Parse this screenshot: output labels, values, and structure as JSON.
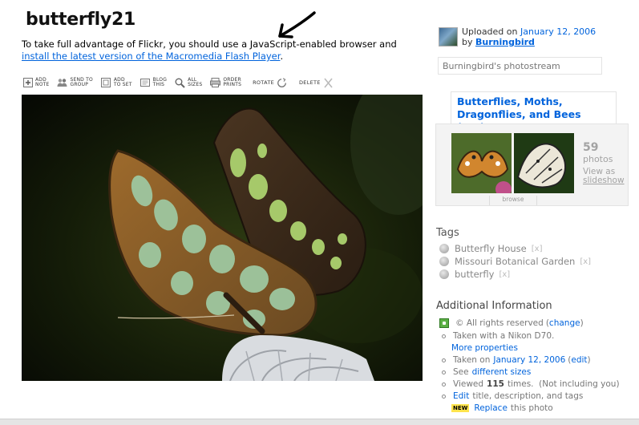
{
  "photo": {
    "title": "butterfly21"
  },
  "notice": {
    "text": "To take full advantage of Flickr, you should use a JavaScript-enabled browser and",
    "link": "install the latest version of the Macromedia Flash Player",
    "end": "."
  },
  "toolbar": {
    "items": [
      {
        "label": "ADD\nNOTE",
        "icon": "add-note-icon"
      },
      {
        "label": "SEND TO\nGROUP",
        "icon": "send-to-group-icon"
      },
      {
        "label": "ADD\nTO SET",
        "icon": "add-to-set-icon"
      },
      {
        "label": "BLOG\nTHIS",
        "icon": "blog-this-icon"
      },
      {
        "label": "ALL\nSIZES",
        "icon": "all-sizes-icon"
      },
      {
        "label": "ORDER\nPRINTS",
        "icon": "order-prints-icon"
      }
    ],
    "rotate": "ROTATE",
    "delete": "DELETE"
  },
  "uploader": {
    "uploaded_on": "Uploaded on",
    "date": "January 12, 2006",
    "by": "by",
    "user": "Burningbird"
  },
  "photostream": {
    "label": "Burningbird's photostream"
  },
  "set": {
    "title": "Butterflies, Moths, Dragonflies, and Bees (Set)",
    "count": "59",
    "count_label": "photos",
    "view_as": "View as",
    "slideshow": "slideshow",
    "browse": "browse"
  },
  "tags": {
    "heading": "Tags",
    "items": [
      {
        "label": "Butterfly House",
        "remove": "[x]"
      },
      {
        "label": "Missouri Botanical Garden",
        "remove": "[x]"
      },
      {
        "label": "butterfly",
        "remove": "[x]"
      }
    ]
  },
  "info": {
    "heading": "Additional Information",
    "rights": "© All rights reserved",
    "change": "change",
    "camera": "Taken with a Nikon D70.",
    "more_props": "More properties",
    "taken_on": "Taken on",
    "taken_date": "January 12, 2006",
    "edit": "edit",
    "see": "See",
    "sizes": "different sizes",
    "viewed_pre": "Viewed",
    "views": "115",
    "viewed_post": "times.  (Not including you)",
    "edit_link": "Edit",
    "edit_rest": "title, description, and tags",
    "new_badge": "NEW",
    "replace": "Replace",
    "replace_rest": "this photo"
  },
  "colors": {
    "link": "#0063dc",
    "muted": "#888888"
  }
}
